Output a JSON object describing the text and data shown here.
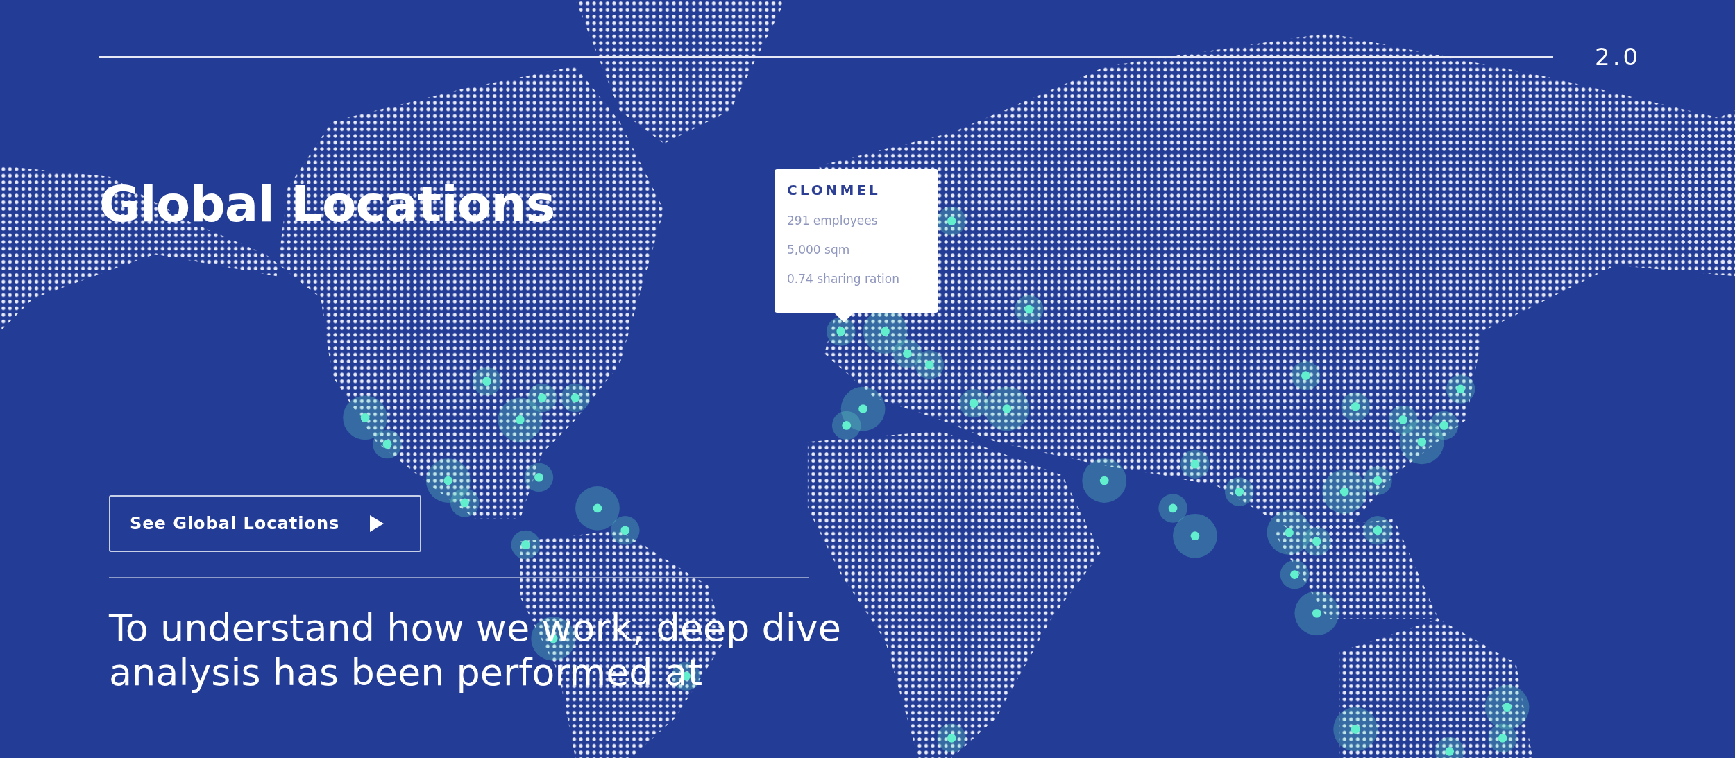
{
  "header": {
    "section_number": "2.0"
  },
  "title": "Global Locations",
  "tooltip": {
    "name": "CLONMEL",
    "lines": [
      "291 employees",
      "5,000 sqm",
      "0.74 sharing ration"
    ]
  },
  "cta_button": {
    "label": "See Global Locations"
  },
  "intro_text": {
    "lines": [
      "To understand how we work, deep dive",
      "analysis has been performed at"
    ]
  }
}
